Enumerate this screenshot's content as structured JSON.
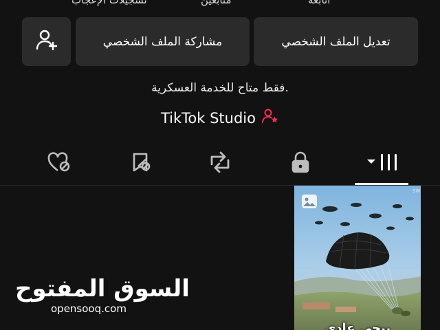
{
  "stats": {
    "following_label": "أتابعة",
    "followers_label": "متابعين",
    "likes_label": "تسجيلات الإعجاب"
  },
  "profile_buttons": {
    "edit_label": "تعديل الملف الشخصي",
    "share_label": "مشاركة الملف الشخصي",
    "add_friend_icon": "add-user-icon"
  },
  "bio": "فقط متاح للخدمة العسكرية.",
  "studio": {
    "label": "TikTok Studio",
    "icon": "user-star-icon",
    "icon_color": "#fe2c55"
  },
  "tabs": [
    {
      "icon": "videos-grid-icon",
      "selected": true
    },
    {
      "icon": "lock-icon",
      "selected": false
    },
    {
      "icon": "repost-icon",
      "selected": false
    },
    {
      "icon": "favorites-hidden-icon",
      "selected": false
    },
    {
      "icon": "liked-hidden-icon",
      "selected": false
    }
  ],
  "videos": [
    {
      "caption": "ببجي عادي",
      "badge_icon": "image-icon"
    }
  ],
  "watermark": {
    "name": "السوق المفتوح",
    "domain": "opensooq.com"
  },
  "colors": {
    "background": "#121212",
    "button": "#2b2b2b",
    "accent": "#fe2c55"
  }
}
